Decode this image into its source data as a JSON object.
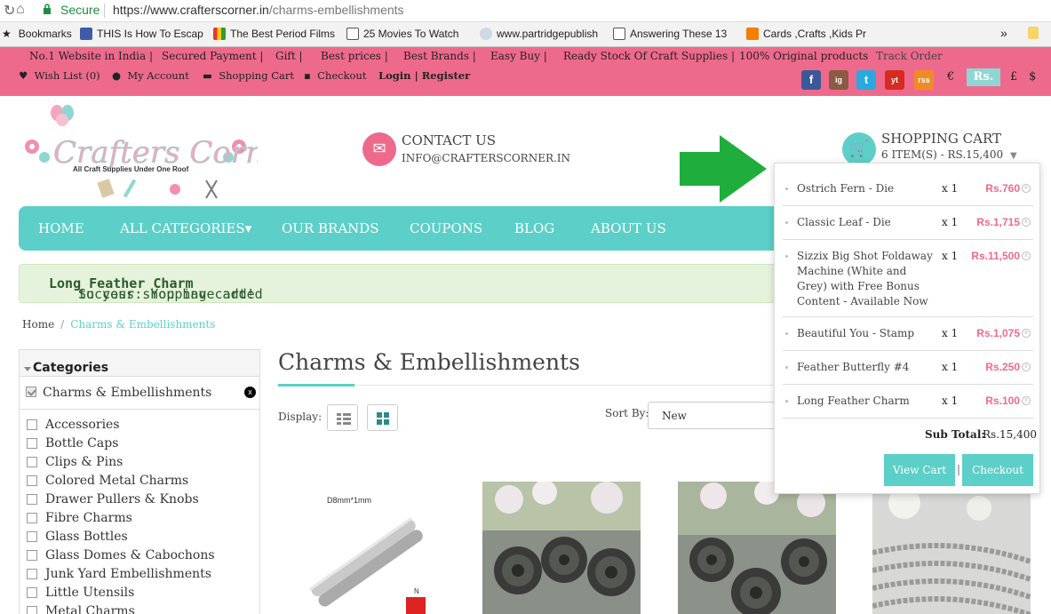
{
  "browser": {
    "secure_label": "Secure",
    "url_host": "https://www.crafterscorner.in",
    "url_path": "/charms-embellishments",
    "bookmarks": [
      {
        "label": "Bookmarks",
        "icon": "star-icon"
      },
      {
        "label": "THIS Is How To Escap",
        "icon": "page-icon"
      },
      {
        "label": "The Best Period Films",
        "icon": "page-icon"
      },
      {
        "label": "25 Movies To Watch",
        "icon": "page-icon"
      },
      {
        "label": "www.partridgepublish",
        "icon": "page-icon"
      },
      {
        "label": "Answering These 13",
        "icon": "page-icon"
      },
      {
        "label": "Cards ,Crafts ,Kids Pr",
        "icon": "blogger-icon"
      }
    ],
    "more": "»"
  },
  "topbar": {
    "promos": [
      "No.1 Website in India |",
      "Secured Payment |",
      "Gift |",
      "Best prices |",
      "Best Brands |",
      "Easy Buy |",
      "Ready Stock Of Craft Supplies |",
      "100% Original products",
      "Track Order"
    ],
    "links": {
      "wishlist": "Wish List (0)",
      "account": "My Account",
      "cart": "Shopping Cart",
      "checkout": "Checkout",
      "login": "Login | Register"
    },
    "social": [
      "f",
      "ig",
      "t",
      "yt",
      "rss"
    ],
    "currencies": [
      "€",
      "Rs.",
      "£",
      "$"
    ]
  },
  "header": {
    "logo_text": "Crafters Corner",
    "logo_tagline": "All Craft Supplies Under One Roof",
    "contact_title": "CONTACT US",
    "contact_email": "INFO@CRAFTERSCORNER.IN",
    "cart_title": "SHOPPING CART",
    "cart_summary": "6 ITEM(S) - RS.15,400"
  },
  "nav": [
    "HOME",
    "ALL CATEGORIES▾",
    "OUR BRANDS",
    "COUPONS",
    "BLOG",
    "ABOUT US"
  ],
  "success": {
    "prefix": "Success: You have added ",
    "product": "Long Feather Charm",
    "suffix": " to your shopping cart!"
  },
  "breadcrumb": {
    "home": "Home",
    "sep": "/",
    "current": "Charms & Embellishments"
  },
  "sidebar": {
    "heading": "Categories",
    "selected": "Charms & Embellishments",
    "remove": "x",
    "items": [
      "Accessories",
      "Bottle Caps",
      "Clips & Pins",
      "Colored Metal Charms",
      "Drawer Pullers & Knobs",
      "Fibre Charms",
      "Glass Bottles",
      "Glass Domes & Cabochons",
      "Junk Yard Embellishments",
      "Little Utensils",
      "Metal Charms"
    ]
  },
  "main": {
    "title": "Charms & Embellishments",
    "display_label": "Display:",
    "sort_label": "Sort By:",
    "sort_value": "New",
    "product1_label": "D8mm*1mm"
  },
  "cart_dropdown": {
    "items": [
      {
        "name": "Ostrich Fern - Die",
        "qty": "x 1",
        "price": "Rs.760"
      },
      {
        "name": "Classic Leaf - Die",
        "qty": "x 1",
        "price": "Rs.1,715"
      },
      {
        "name": "Sizzix Big Shot Foldaway Machine (White and Grey) with Free Bonus Content - Available Now",
        "qty": "x 1",
        "price": "Rs.11,500"
      },
      {
        "name": "Beautiful You - Stamp",
        "qty": "x 1",
        "price": "Rs.1,075"
      },
      {
        "name": "Feather Butterfly #4",
        "qty": "x 1",
        "price": "Rs.250"
      },
      {
        "name": "Long Feather Charm",
        "qty": "x 1",
        "price": "Rs.100"
      }
    ],
    "subtotal_label": "Sub Total:",
    "subtotal_value": "Rs.15,400",
    "view_cart": "View Cart",
    "separator": "|",
    "checkout": "Checkout"
  },
  "colors": {
    "pink": "#ee6a8c",
    "teal": "#5ccfc8",
    "arrow": "#1fae3c",
    "success_bg": "#e6f3dc"
  }
}
